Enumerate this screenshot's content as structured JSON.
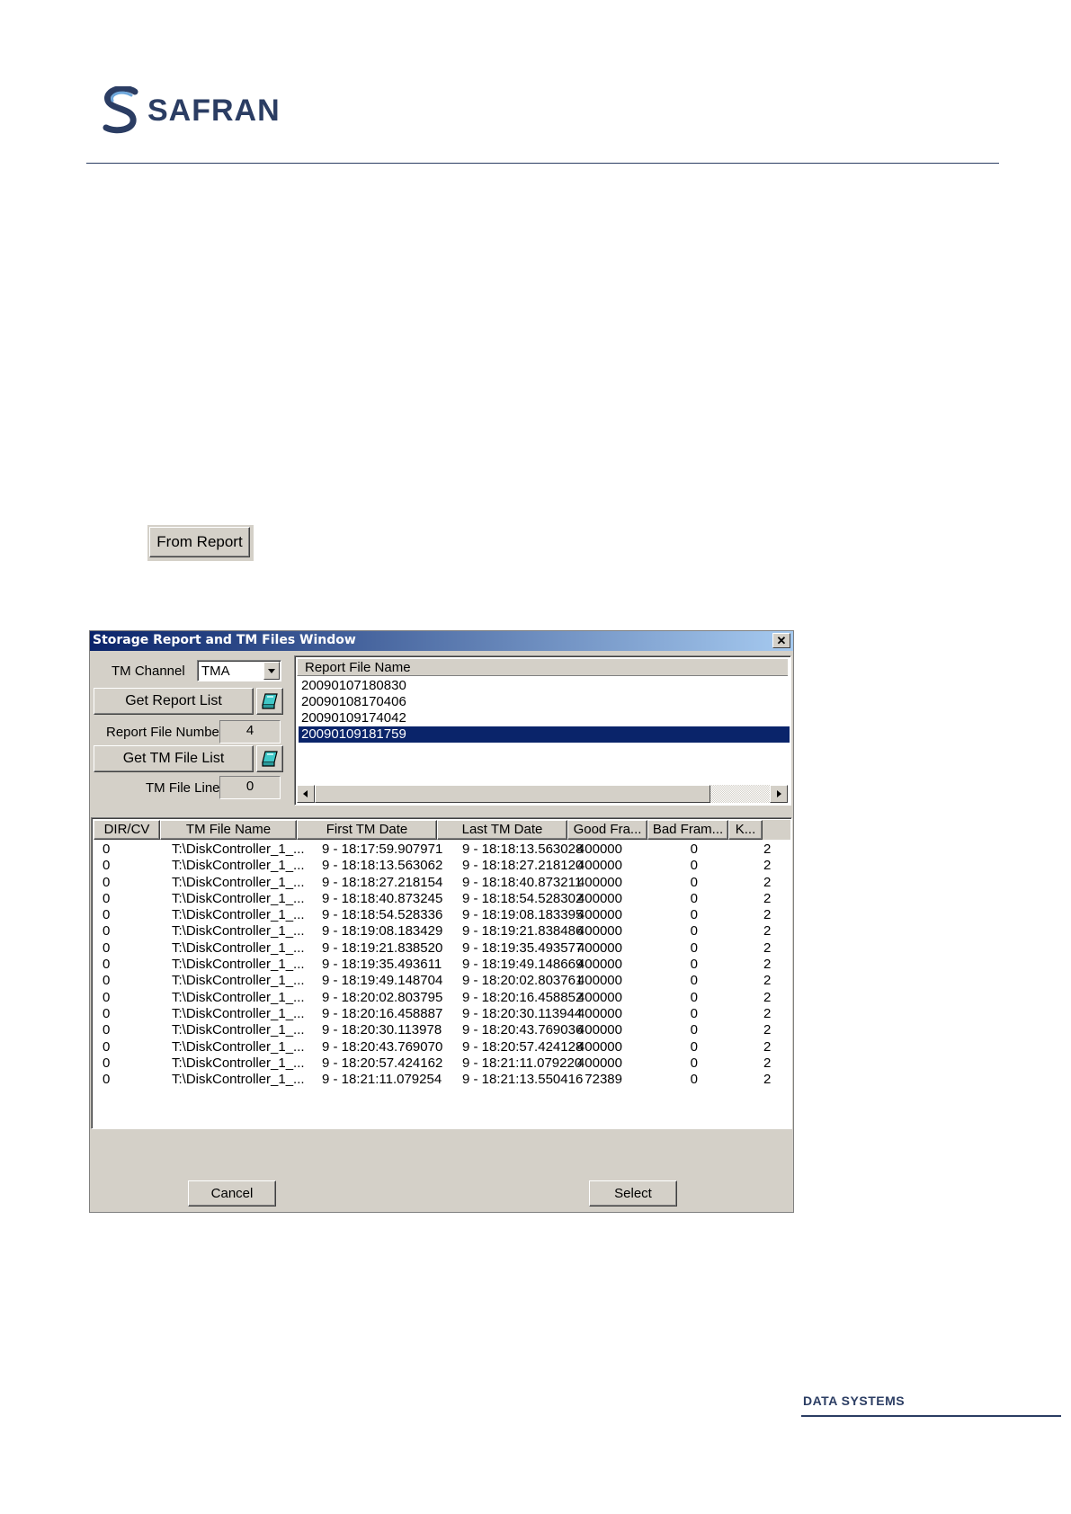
{
  "brand": {
    "logo_text": "SAFRAN",
    "footer_label": "DATA SYSTEMS",
    "color": "#2b3d63"
  },
  "from_report_button": "From Report",
  "dialog": {
    "title": "Storage Report and TM Files Window",
    "close_label": "✕",
    "tm_channel_label": "TM Channel",
    "tm_channel_value": "TMA",
    "get_report_list_label": "Get Report List",
    "report_file_number_label": "Report File Number",
    "report_file_number_value": "4",
    "get_tm_file_list_label": "Get TM File List",
    "tm_file_line_label": "TM File Line",
    "tm_file_line_value": "0",
    "report_list": {
      "header": "Report File Name",
      "items": [
        "20090107180830",
        "20090108170406",
        "20090109174042",
        "20090109181759"
      ],
      "selected_index": 3
    },
    "tm_table": {
      "columns": [
        "DIR/CV",
        "TM File Name",
        "First TM Date",
        "Last  TM Date",
        "Good Fra...",
        "Bad Fram...",
        "K..."
      ],
      "rows": [
        [
          "0",
          "T:\\DiskController_1_...",
          "9 - 18:17:59.907971",
          "9 - 18:18:13.563028",
          "400000",
          "0",
          "2"
        ],
        [
          "0",
          "T:\\DiskController_1_...",
          "9 - 18:18:13.563062",
          "9 - 18:18:27.218120",
          "400000",
          "0",
          "2"
        ],
        [
          "0",
          "T:\\DiskController_1_...",
          "9 - 18:18:27.218154",
          "9 - 18:18:40.873211",
          "400000",
          "0",
          "2"
        ],
        [
          "0",
          "T:\\DiskController_1_...",
          "9 - 18:18:40.873245",
          "9 - 18:18:54.528302",
          "400000",
          "0",
          "2"
        ],
        [
          "0",
          "T:\\DiskController_1_...",
          "9 - 18:18:54.528336",
          "9 - 18:19:08.183395",
          "400000",
          "0",
          "2"
        ],
        [
          "0",
          "T:\\DiskController_1_...",
          "9 - 18:19:08.183429",
          "9 - 18:19:21.838486",
          "400000",
          "0",
          "2"
        ],
        [
          "0",
          "T:\\DiskController_1_...",
          "9 - 18:19:21.838520",
          "9 - 18:19:35.493577",
          "400000",
          "0",
          "2"
        ],
        [
          "0",
          "T:\\DiskController_1_...",
          "9 - 18:19:35.493611",
          "9 - 18:19:49.148669",
          "400000",
          "0",
          "2"
        ],
        [
          "0",
          "T:\\DiskController_1_...",
          "9 - 18:19:49.148704",
          "9 - 18:20:02.803761",
          "400000",
          "0",
          "2"
        ],
        [
          "0",
          "T:\\DiskController_1_...",
          "9 - 18:20:02.803795",
          "9 - 18:20:16.458852",
          "400000",
          "0",
          "2"
        ],
        [
          "0",
          "T:\\DiskController_1_...",
          "9 - 18:20:16.458887",
          "9 - 18:20:30.113944",
          "400000",
          "0",
          "2"
        ],
        [
          "0",
          "T:\\DiskController_1_...",
          "9 - 18:20:30.113978",
          "9 - 18:20:43.769036",
          "400000",
          "0",
          "2"
        ],
        [
          "0",
          "T:\\DiskController_1_...",
          "9 - 18:20:43.769070",
          "9 - 18:20:57.424128",
          "400000",
          "0",
          "2"
        ],
        [
          "0",
          "T:\\DiskController_1_...",
          "9 - 18:20:57.424162",
          "9 - 18:21:11.079220",
          "400000",
          "0",
          "2"
        ],
        [
          "0",
          "T:\\DiskController_1_...",
          "9 - 18:21:11.079254",
          "9 - 18:21:13.550416",
          "72389",
          "0",
          "2"
        ]
      ]
    },
    "cancel_label": "Cancel",
    "select_label": "Select"
  }
}
